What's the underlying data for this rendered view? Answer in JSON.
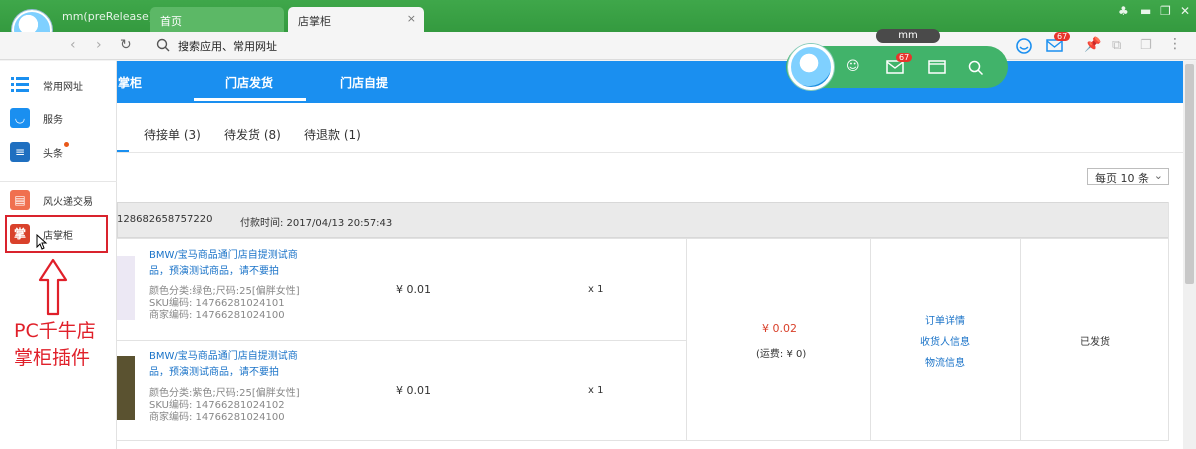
{
  "browser": {
    "app_title": "mm(preRelease)",
    "tabs": [
      {
        "label": "首页"
      },
      {
        "label": "店掌柜",
        "close": "×"
      }
    ],
    "search_placeholder": "搜索应用、常用网址",
    "mm_pill": "mm",
    "mail_badge": "67"
  },
  "sidebar": {
    "items": [
      {
        "label": "常用网址",
        "icon": "list-icon"
      },
      {
        "label": "服务",
        "icon": "bag-icon"
      },
      {
        "label": "头条",
        "icon": "news-icon"
      },
      {
        "label": "风火递交易",
        "icon": "box-icon"
      },
      {
        "label": "店掌柜",
        "icon": "zhang-icon",
        "glyph": "掌"
      }
    ],
    "annotation_line1": "PC千牛店",
    "annotation_line2": "掌柜插件"
  },
  "main": {
    "top_tabs": [
      {
        "label": "掌柜"
      },
      {
        "label": "门店发货"
      },
      {
        "label": "门店自提"
      }
    ],
    "sub_tabs": [
      {
        "label": "待接单 (3)"
      },
      {
        "label": "待发货 (8)"
      },
      {
        "label": "待退款 (1)"
      }
    ],
    "per_page": "每页 10 条",
    "widget_badge": "67",
    "order": {
      "order_no": "128682658757220",
      "pay_time": "付款时间: 2017/04/13 20:57:43",
      "items": [
        {
          "title_line1": "BMW/宝马商品通门店自提测试商",
          "title_line2": "品，预演测试商品，请不要拍",
          "color_size": "颜色分类:绿色;尺码:25[偏胖女性]",
          "sku": "SKU编码: 14766281024101",
          "merchant_code": "商家编码: 14766281024100",
          "price": "¥ 0.01",
          "qty": "x 1"
        },
        {
          "title_line1": "BMW/宝马商品通门店自提测试商",
          "title_line2": "品，预演测试商品，请不要拍",
          "color_size": "颜色分类:紫色;尺码:25[偏胖女性]",
          "sku": "SKU编码: 14766281024102",
          "merchant_code": "商家编码: 14766281024100",
          "price": "¥ 0.01",
          "qty": "x 1"
        }
      ],
      "total": "¥ 0.02",
      "shipping": "(运费: ¥ 0)",
      "links": [
        "订单详情",
        "收货人信息",
        "物流信息"
      ],
      "status": "已发货"
    }
  },
  "colors": {
    "titlebar": "#3fa74a",
    "blue": "#1a8ff0",
    "annotation": "#e0202a"
  }
}
